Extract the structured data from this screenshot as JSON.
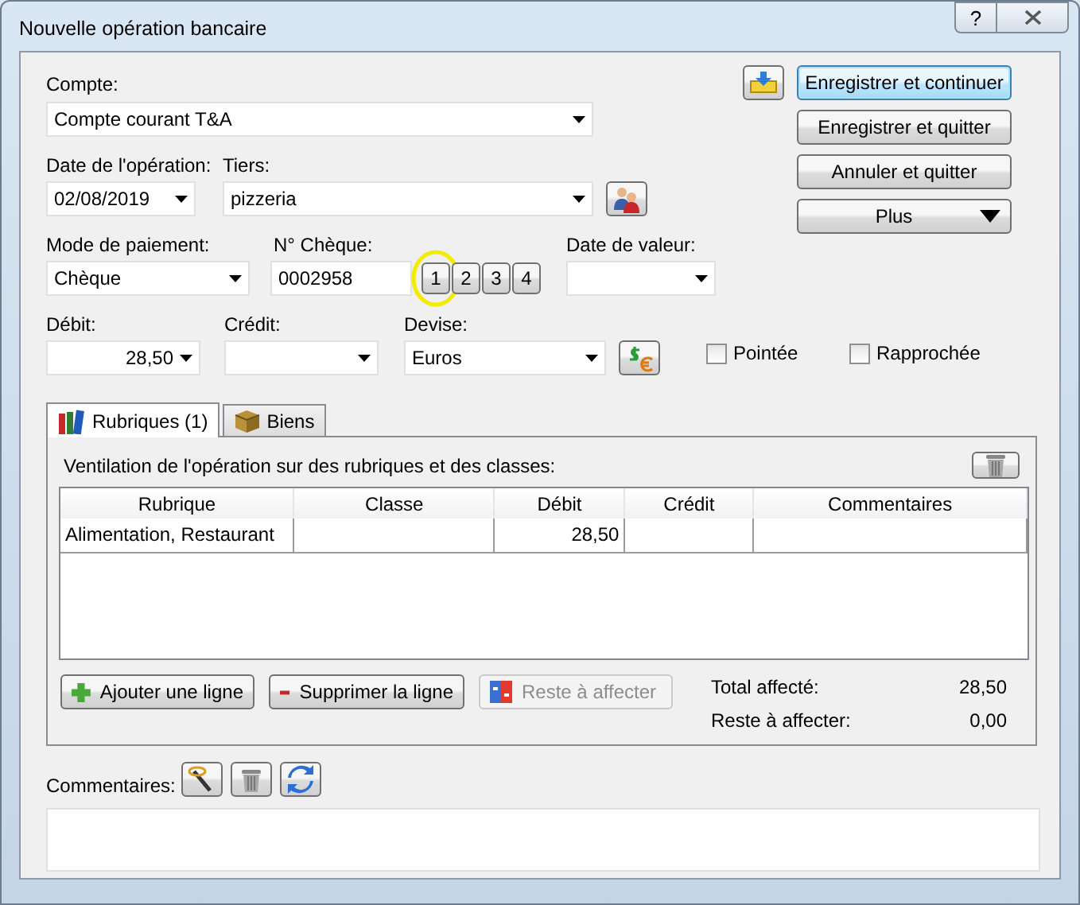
{
  "window": {
    "title": "Nouvelle opération bancaire",
    "help_button": "?"
  },
  "account": {
    "label": "Compte:",
    "value": "Compte courant T&A"
  },
  "operation_date": {
    "label": "Date de l'opération:",
    "value": "02/08/2019"
  },
  "payee": {
    "label": "Tiers:",
    "value": "pizzeria"
  },
  "payment_mode": {
    "label": "Mode de paiement:",
    "value": "Chèque"
  },
  "cheque_number": {
    "label": "N° Chèque:",
    "value": "0002958",
    "buttons": [
      {
        "label": "1",
        "highlighted": true
      },
      {
        "label": "2",
        "highlighted": false
      },
      {
        "label": "3",
        "highlighted": false
      },
      {
        "label": "4",
        "highlighted": false
      }
    ]
  },
  "value_date": {
    "label": "Date de valeur:"
  },
  "debit": {
    "label": "Débit:",
    "value": "28,50"
  },
  "credit": {
    "label": "Crédit:"
  },
  "currency": {
    "label": "Devise:",
    "value": "Euros"
  },
  "checkboxes": [
    {
      "label": "Pointée",
      "checked": false
    },
    {
      "label": "Rapprochée",
      "checked": false
    }
  ],
  "actions": [
    {
      "kind": "button",
      "label": "Enregistrer et continuer",
      "default": true
    },
    {
      "kind": "button",
      "label": "Enregistrer et quitter",
      "default": false
    },
    {
      "kind": "button",
      "label": "Annuler et quitter",
      "default": false
    },
    {
      "kind": "menu",
      "label": "Plus",
      "default": false
    }
  ],
  "tabs": [
    {
      "label": "Rubriques (1)",
      "selected": true
    },
    {
      "label": "Biens",
      "selected": false
    }
  ],
  "breakdown": {
    "caption": "Ventilation de l'opération sur des rubriques et des classes:",
    "columns": [
      "Rubrique",
      "Classe",
      "Débit",
      "Crédit",
      "Commentaires"
    ],
    "rows": [
      {
        "cells": [
          "Alimentation, Restaurant",
          null,
          "28,50",
          null,
          null
        ]
      }
    ]
  },
  "line_buttons": [
    {
      "label": "Ajouter une ligne",
      "disabled": false
    },
    {
      "label": "Supprimer la ligne",
      "disabled": false
    },
    {
      "label": "Reste à affecter",
      "disabled": true
    }
  ],
  "totals": [
    {
      "label": "Total affecté:",
      "value": "28,50"
    },
    {
      "label": "Reste à affecter:",
      "value": "0,00"
    }
  ],
  "comments": {
    "label": "Commentaires:"
  }
}
